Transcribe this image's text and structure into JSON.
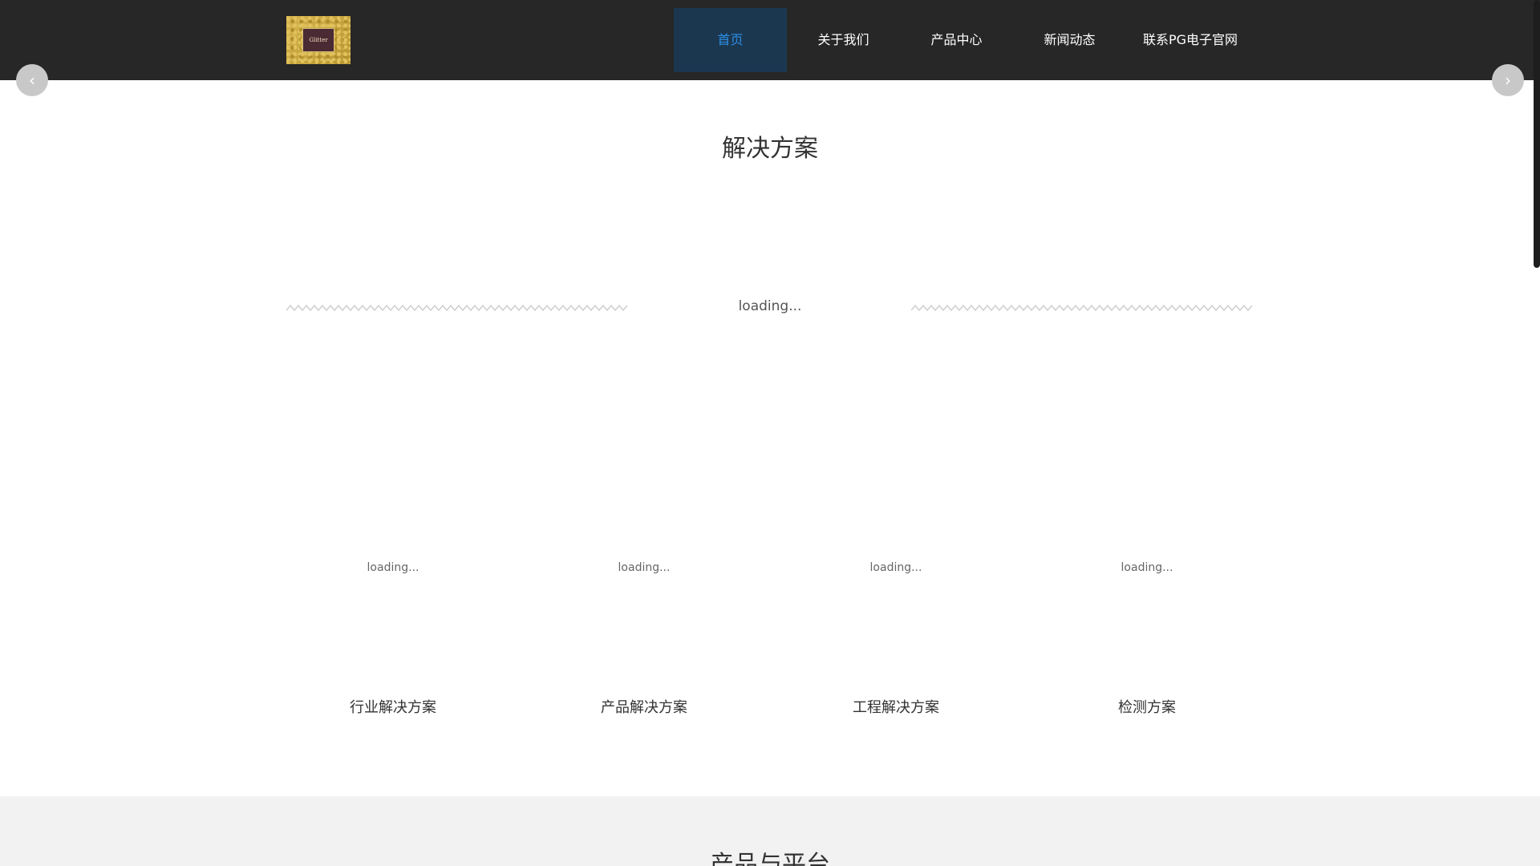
{
  "header": {
    "logo_text": "Glitter",
    "nav": [
      {
        "label": "首页"
      },
      {
        "label": "关于我们"
      },
      {
        "label": "产品中心"
      },
      {
        "label": "新闻动态"
      },
      {
        "label": "联系PG电子官网"
      }
    ]
  },
  "carousel": {
    "prev_icon": "chevron-left-icon",
    "next_icon": "chevron-right-icon",
    "prev_glyph": "‹",
    "next_glyph": "›"
  },
  "solutions": {
    "title": "解决方案",
    "loading": "loading...",
    "cards": [
      {
        "loading": "loading...",
        "label": "行业解决方案"
      },
      {
        "loading": "loading...",
        "label": "产品解决方案"
      },
      {
        "loading": "loading...",
        "label": "工程解决方案"
      },
      {
        "loading": "loading...",
        "label": "检测方案"
      }
    ]
  },
  "products": {
    "title": "产品与平台"
  },
  "colors": {
    "header_bg": "#272727",
    "nav_active_bg": "#1b3750",
    "nav_active_text": "#2e8fe6",
    "lower_bg": "#f2f2f2"
  }
}
